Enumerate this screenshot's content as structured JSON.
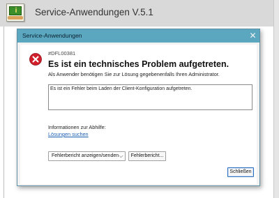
{
  "app": {
    "title": "Service-Anwendungen V.5.1"
  },
  "dialog": {
    "title": "Service-Anwendungen",
    "close_glyph": "✕",
    "error_code": "#DFL00381",
    "heading": "Es ist ein technisches Problem aufgetreten.",
    "subtext": "Als Anwender benötigen Sie zur Lösung gegebenenfalls Ihren Administrator.",
    "message": "Es ist ein Fehler beim Laden der Client-Konfiguration aufgetreten.",
    "info_label": "Informationen zur Abhilfe:",
    "info_link": "Lösungen suchen",
    "report_select": {
      "selected": "Fehlerbericht anzeigen/senden",
      "chevron": "⌵"
    },
    "report_button": "Fehlerbericht...",
    "close_button": "Schließen"
  },
  "colors": {
    "dialog_titlebar": "#5ba7bf",
    "error_red": "#d01f2a",
    "link": "#1a5fb4",
    "default_button_border": "#2f6fbf"
  },
  "icons": {
    "app_icon": "service-app-icon",
    "error_icon": "error-x-icon"
  }
}
